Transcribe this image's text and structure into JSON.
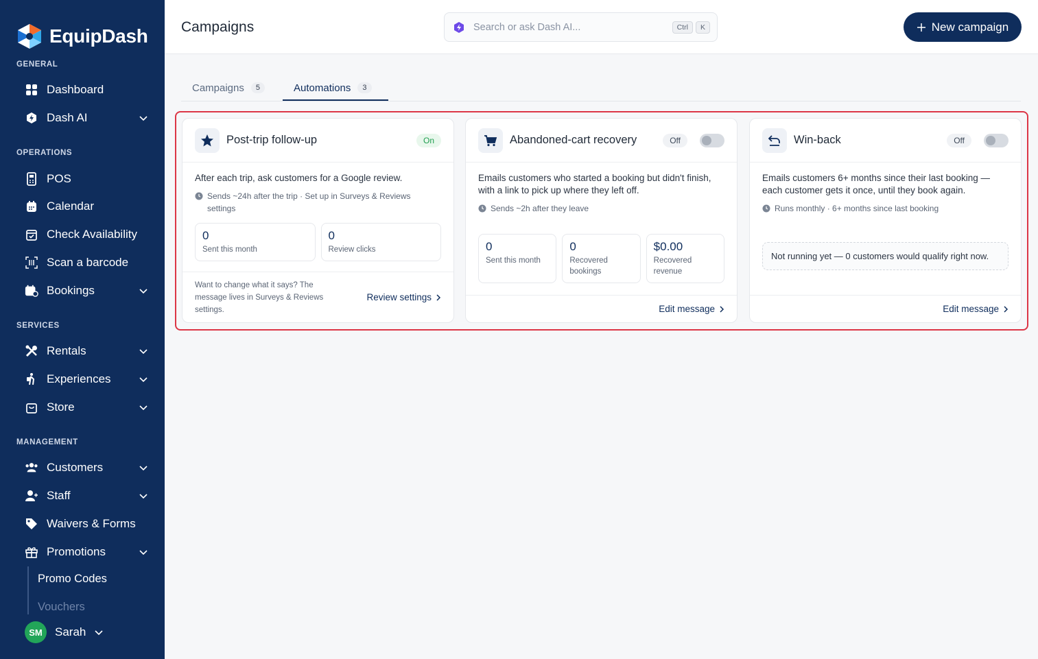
{
  "brand": {
    "name": "EquipDash"
  },
  "sidebar": {
    "sections": {
      "general": "GENERAL",
      "operations": "OPERATIONS",
      "services": "SERVICES",
      "management": "MANAGEMENT"
    },
    "items": {
      "dashboard": "Dashboard",
      "dash_ai": "Dash AI",
      "pos": "POS",
      "calendar": "Calendar",
      "check_availability": "Check Availability",
      "scan_barcode": "Scan a barcode",
      "bookings": "Bookings",
      "rentals": "Rentals",
      "experiences": "Experiences",
      "store": "Store",
      "customers": "Customers",
      "staff": "Staff",
      "waivers_forms": "Waivers & Forms",
      "promotions": "Promotions"
    },
    "sub_items": {
      "promo_codes": "Promo Codes",
      "vouchers": "Vouchers"
    },
    "user": {
      "initials": "SM",
      "name": "Sarah"
    }
  },
  "header": {
    "title": "Campaigns",
    "search_placeholder": "Search or ask Dash AI...",
    "kbd_ctrl": "Ctrl",
    "kbd_k": "K",
    "new_campaign_label": "New campaign"
  },
  "tabs": [
    {
      "label": "Campaigns",
      "count": "5"
    },
    {
      "label": "Automations",
      "count": "3"
    }
  ],
  "cards": [
    {
      "title": "Post-trip follow-up",
      "status": "On",
      "description": "After each trip, ask customers for a Google review.",
      "meta": "Sends ~24h after the trip · Set up in Surveys & Reviews settings",
      "stats": [
        {
          "value": "0",
          "label": "Sent this month"
        },
        {
          "value": "0",
          "label": "Review clicks"
        }
      ],
      "footer_note": "Want to change what it says? The message lives in Surveys & Reviews settings.",
      "footer_link": "Review settings"
    },
    {
      "title": "Abandoned-cart recovery",
      "status": "Off",
      "description": "Emails customers who started a booking but didn't finish, with a link to pick up where they left off.",
      "meta": "Sends ~2h after they leave",
      "stats": [
        {
          "value": "0",
          "label": "Sent this month"
        },
        {
          "value": "0",
          "label": "Recovered bookings"
        },
        {
          "value": "$0.00",
          "label": "Recovered revenue"
        }
      ],
      "footer_link": "Edit message"
    },
    {
      "title": "Win-back",
      "status": "Off",
      "description": "Emails customers 6+ months since their last booking — each customer gets it once, until they book again.",
      "meta": "Runs monthly · 6+ months since last booking",
      "notice": "Not running yet — 0 customers would qualify right now.",
      "footer_link": "Edit message"
    }
  ],
  "colors": {
    "sidebar_bg": "#0f2d5c",
    "accent": "#0f2d5c",
    "status_on": "#1f9d4f",
    "highlight": "#dc3545",
    "avatar": "#22a559"
  }
}
